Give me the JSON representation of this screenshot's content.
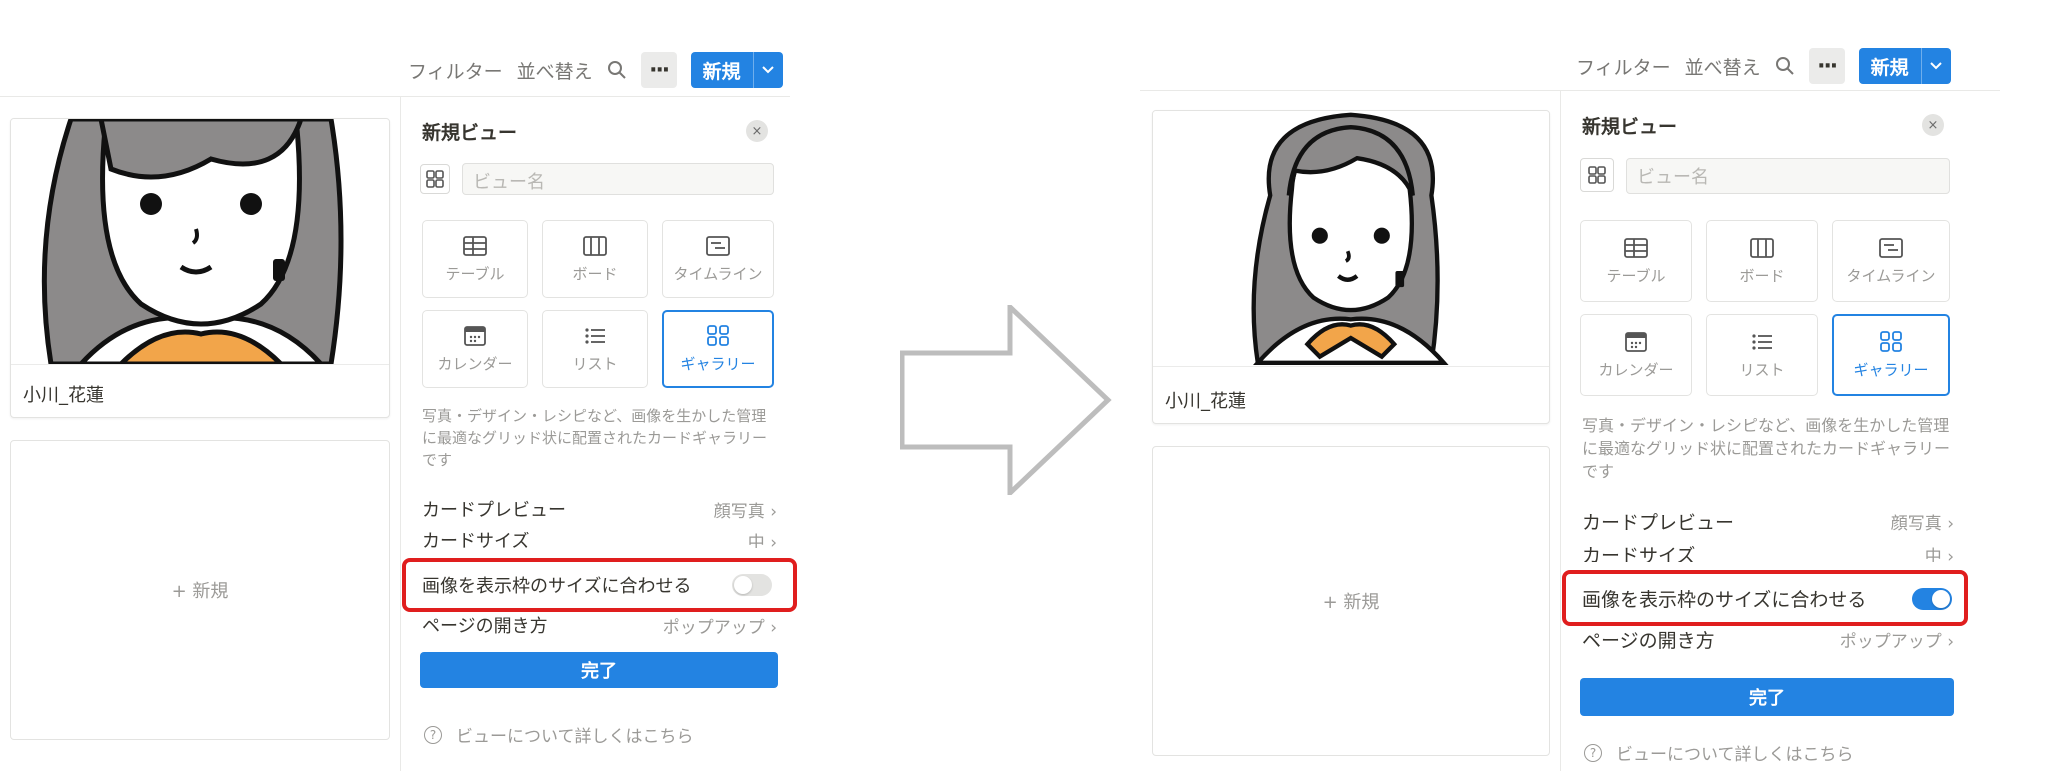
{
  "toolbar": {
    "filter_label": "フィルター",
    "sort_label": "並べ替え",
    "more_label": "···",
    "new_label": "新規"
  },
  "gallery": {
    "card_name": "小川_花蓮",
    "new_card_label": "+ 新規"
  },
  "settings": {
    "title": "新規ビュー",
    "close_label": "×",
    "name_placeholder": "ビュー名",
    "layouts": [
      {
        "label": "テーブル",
        "icon": "table-icon"
      },
      {
        "label": "ボード",
        "icon": "board-icon"
      },
      {
        "label": "タイムライン",
        "icon": "timeline-icon"
      },
      {
        "label": "カレンダー",
        "icon": "calendar-icon"
      },
      {
        "label": "リスト",
        "icon": "list-icon"
      },
      {
        "label": "ギャラリー",
        "icon": "gallery-icon",
        "selected": true
      }
    ],
    "description": "写真・デザイン・レシピなど、画像を生かした管理に最適なグリッド状に配置されたカードギャラリーです",
    "card_preview_label": "カードプレビュー",
    "card_preview_value": "顔写真",
    "card_size_label": "カードサイズ",
    "card_size_value": "中",
    "fit_image_label": "画像を表示枠のサイズに合わせる",
    "open_page_label": "ページの開き方",
    "open_page_value": "ポップアップ",
    "done_label": "完了",
    "help_label": "ビューについて詳しくはこちら"
  },
  "before": {
    "fit_image_toggle": "off"
  },
  "after": {
    "fit_image_toggle": "on"
  },
  "colors": {
    "accent": "#2383e2",
    "highlight": "#e01e1e",
    "arrow": "#bdbdbd"
  }
}
